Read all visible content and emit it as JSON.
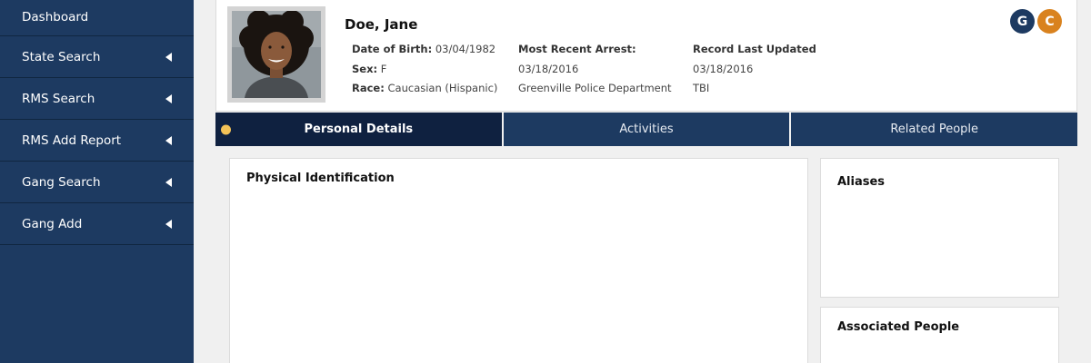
{
  "sidebar": {
    "items": [
      {
        "label": "Dashboard"
      },
      {
        "label": "State Search"
      },
      {
        "label": "RMS Search"
      },
      {
        "label": "RMS Add Report"
      },
      {
        "label": "Gang Search"
      },
      {
        "label": "Gang Add"
      }
    ]
  },
  "header": {
    "name": "Doe, Jane",
    "dob_label": "Date of Birth:",
    "dob_value": "03/04/1982",
    "sex_label": "Sex:",
    "sex_value": "F",
    "race_label": "Race:",
    "race_value": "Caucasian (Hispanic)",
    "arrest_label": "Most Recent Arrest:",
    "arrest_date": "03/18/2016",
    "arrest_agency": "Greenville Police Department",
    "updated_label": "Record Last Updated",
    "updated_date": "03/18/2016",
    "updated_by": "TBI",
    "badges": [
      {
        "letter": "G",
        "color": "#1d3a61"
      },
      {
        "letter": "C",
        "color": "#d9821e"
      }
    ]
  },
  "tabs": [
    {
      "label": "Personal Details",
      "active": true
    },
    {
      "label": "Activities",
      "active": false
    },
    {
      "label": "Related People",
      "active": false
    }
  ],
  "panels": {
    "physical_identification": "Physical Identification",
    "aliases": "Aliases",
    "associated_people": "Associated People"
  },
  "colors": {
    "sidebar": "#1d3a61",
    "tab_active": "#0f2140",
    "indicator_dot": "#f3c257"
  }
}
